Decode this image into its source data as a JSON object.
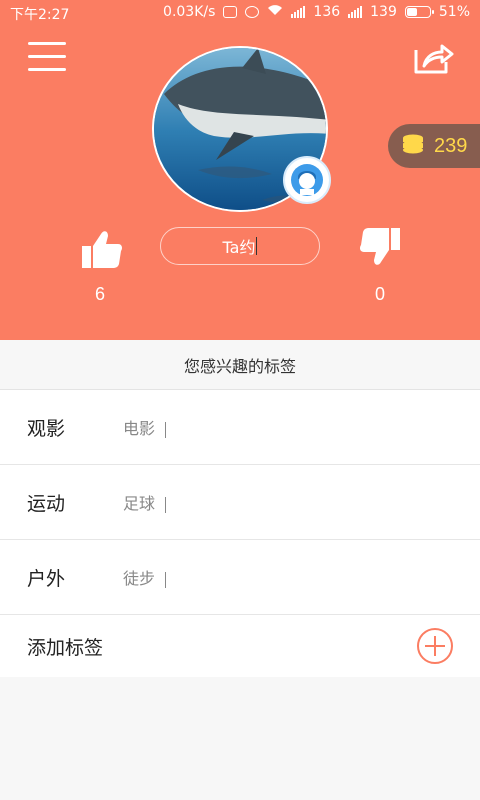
{
  "status_bar": {
    "time": "下午2:27",
    "network_speed": "0.03K/s",
    "signal_1": "136",
    "signal_2": "139",
    "battery": "51%",
    "battery_level": 0.51
  },
  "header": {
    "background_color": "#fb7d62",
    "menu_icon": "hamburger-menu-icon",
    "share_icon": "share-icon"
  },
  "profile": {
    "avatar_description": "shark-photo-avatar",
    "badge_icon": "boy-avatar-icon",
    "coins": "239",
    "ta_button": "Ta约",
    "likes": "6",
    "dislikes": "0"
  },
  "interests": {
    "title": "您感兴趣的标签",
    "items": [
      {
        "category": "观影",
        "value": "电影"
      },
      {
        "category": "运动",
        "value": "足球"
      },
      {
        "category": "户外",
        "value": "徒步"
      }
    ],
    "add_label": "添加标签"
  },
  "colors": {
    "accent": "#fb7d62",
    "coin_badge_bg": "#875d4f",
    "coin_text": "#ffd84a"
  }
}
